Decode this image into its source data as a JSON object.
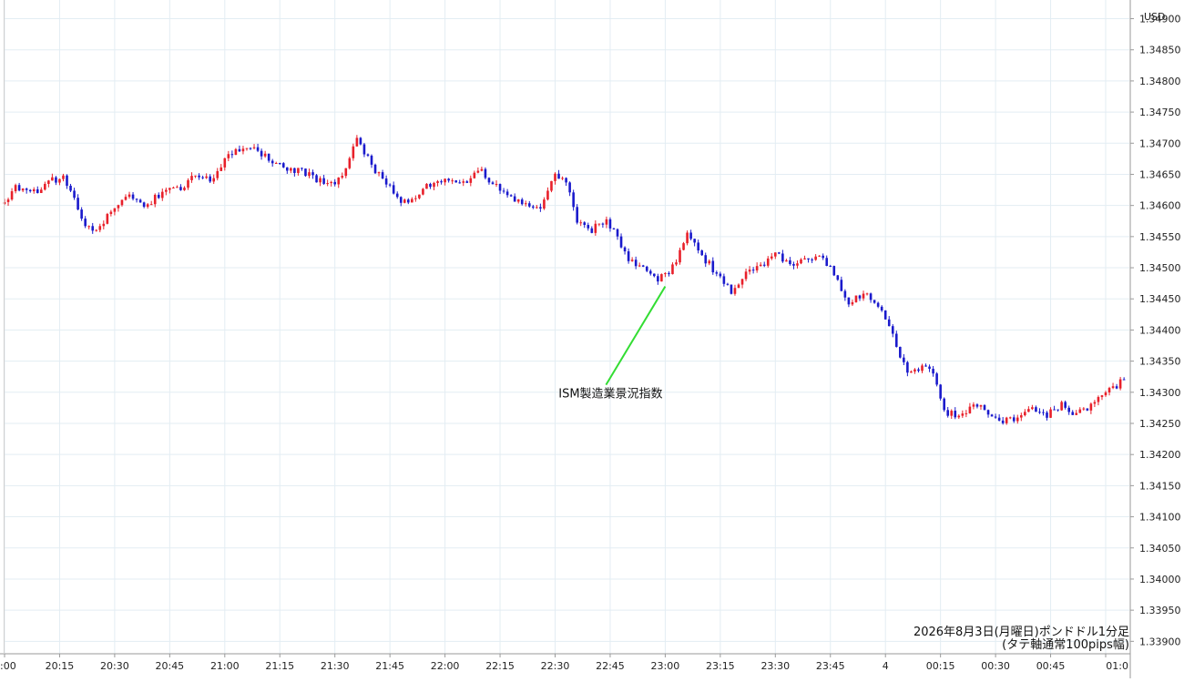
{
  "chart_data": {
    "type": "candlestick",
    "currency_label": "USD",
    "y_ticks": [
      "1.34900",
      "1.34850",
      "1.34800",
      "1.34750",
      "1.34700",
      "1.34650",
      "1.34600",
      "1.34550",
      "1.34500",
      "1.34450",
      "1.34400",
      "1.34350",
      "1.34300",
      "1.34250",
      "1.34200",
      "1.34150",
      "1.34100",
      "1.34050",
      "1.34000",
      "1.33950",
      "1.33900"
    ],
    "ylim": [
      1.3388,
      1.3493
    ],
    "x_ticks": [
      ":00",
      "20:15",
      "20:30",
      "20:45",
      "21:00",
      "21:15",
      "21:30",
      "21:45",
      "22:00",
      "22:15",
      "22:30",
      "22:45",
      "23:00",
      "23:15",
      "23:30",
      "23:45",
      "4",
      "00:15",
      "00:30",
      "00:45",
      "01:0"
    ],
    "x_start": "20:00",
    "interval": "1 minute",
    "up_color": "#e8202a",
    "down_color": "#1a1acc",
    "annotation": {
      "text": "ISM製造業景況指数",
      "time": "23:00",
      "line_color": "#33dd33"
    },
    "caption_line1": "2026年8月3日(月曜日)ポンドドル1分足",
    "caption_line2": "(タテ軸通常100pips幅)",
    "waypoints": [
      [
        0,
        1.346
      ],
      [
        3,
        1.3463
      ],
      [
        8,
        1.3462
      ],
      [
        12,
        1.3464
      ],
      [
        16,
        1.34645
      ],
      [
        19,
        1.3461
      ],
      [
        22,
        1.34565
      ],
      [
        25,
        1.3456
      ],
      [
        29,
        1.3459
      ],
      [
        33,
        1.34615
      ],
      [
        38,
        1.346
      ],
      [
        43,
        1.3462
      ],
      [
        48,
        1.3463
      ],
      [
        53,
        1.3465
      ],
      [
        57,
        1.3464
      ],
      [
        61,
        1.3468
      ],
      [
        66,
        1.34695
      ],
      [
        71,
        1.3468
      ],
      [
        76,
        1.3466
      ],
      [
        81,
        1.34655
      ],
      [
        86,
        1.3464
      ],
      [
        90,
        1.3463
      ],
      [
        93,
        1.34665
      ],
      [
        96,
        1.34705
      ],
      [
        99,
        1.34675
      ],
      [
        103,
        1.3464
      ],
      [
        107,
        1.34615
      ],
      [
        110,
        1.346
      ],
      [
        114,
        1.3463
      ],
      [
        118,
        1.3464
      ],
      [
        122,
        1.34635
      ],
      [
        126,
        1.3464
      ],
      [
        130,
        1.34655
      ],
      [
        134,
        1.3463
      ],
      [
        138,
        1.3461
      ],
      [
        142,
        1.346
      ],
      [
        146,
        1.34595
      ],
      [
        150,
        1.3465
      ],
      [
        153,
        1.34635
      ],
      [
        156,
        1.34575
      ],
      [
        160,
        1.3456
      ],
      [
        164,
        1.3458
      ],
      [
        167,
        1.34545
      ],
      [
        170,
        1.3451
      ],
      [
        174,
        1.345
      ],
      [
        178,
        1.3448
      ],
      [
        182,
        1.345
      ],
      [
        186,
        1.34555
      ],
      [
        190,
        1.3452
      ],
      [
        194,
        1.3449
      ],
      [
        198,
        1.3446
      ],
      [
        202,
        1.34495
      ],
      [
        206,
        1.345
      ],
      [
        210,
        1.34525
      ],
      [
        214,
        1.345
      ],
      [
        218,
        1.3451
      ],
      [
        222,
        1.3452
      ],
      [
        226,
        1.3449
      ],
      [
        230,
        1.3444
      ],
      [
        234,
        1.3446
      ],
      [
        238,
        1.3444
      ],
      [
        242,
        1.3439
      ],
      [
        246,
        1.3433
      ],
      [
        250,
        1.3434
      ],
      [
        253,
        1.3433
      ],
      [
        256,
        1.3427
      ],
      [
        260,
        1.3426
      ],
      [
        264,
        1.3428
      ],
      [
        268,
        1.3427
      ],
      [
        272,
        1.34255
      ],
      [
        276,
        1.3426
      ],
      [
        280,
        1.34275
      ],
      [
        284,
        1.34265
      ],
      [
        288,
        1.3428
      ],
      [
        292,
        1.34265
      ],
      [
        296,
        1.3428
      ],
      [
        300,
        1.343
      ],
      [
        304,
        1.34315
      ],
      [
        308,
        1.34345
      ],
      [
        310,
        1.34345
      ]
    ]
  }
}
